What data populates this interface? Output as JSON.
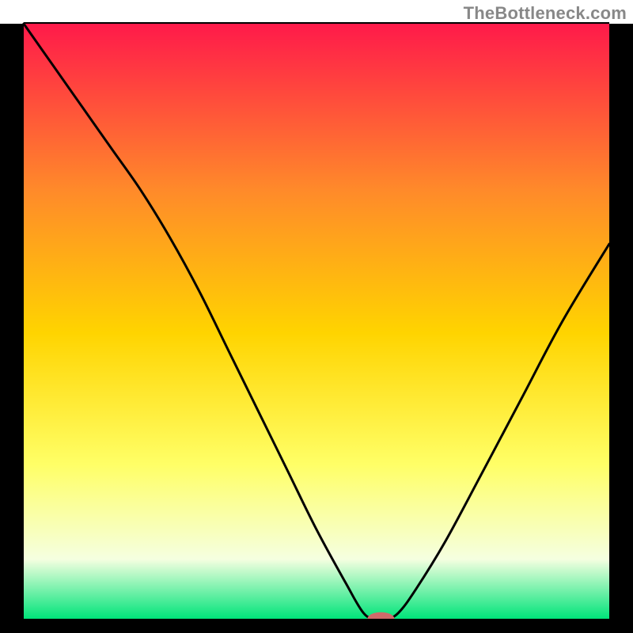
{
  "attribution": "TheBottleneck.com",
  "colors": {
    "frame": "#000000",
    "curve": "#000000",
    "marker_fill": "#cf6a6a",
    "gradient_top": "#ff1a4a",
    "gradient_mid_upper": "#ff8a2a",
    "gradient_mid": "#ffd400",
    "gradient_mid_lower": "#ffff66",
    "gradient_pale": "#f5ffe0",
    "gradient_green": "#00e47a"
  },
  "chart_data": {
    "type": "line",
    "title": "",
    "xlabel": "",
    "ylabel": "",
    "xlim": [
      0,
      100
    ],
    "ylim": [
      0,
      100
    ],
    "x": [
      0,
      5,
      10,
      15,
      20,
      25,
      30,
      35,
      40,
      45,
      50,
      55,
      58,
      60,
      62,
      64,
      67,
      72,
      78,
      85,
      92,
      100
    ],
    "values": [
      100,
      93,
      86,
      79,
      72,
      64,
      55,
      45,
      35,
      25,
      15,
      6,
      1,
      0,
      0,
      1,
      5,
      13,
      24,
      37,
      50,
      63
    ],
    "marker": {
      "x": 61,
      "y": 0,
      "rx": 2.3,
      "ry": 1.1
    },
    "grid": false,
    "legend": false
  }
}
